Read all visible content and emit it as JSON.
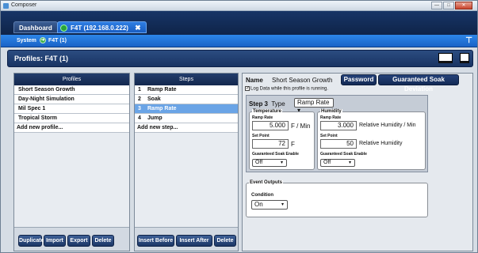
{
  "window": {
    "title": "Composer"
  },
  "tabs": [
    {
      "label": "Dashboard"
    },
    {
      "label": "F4T (192.168.0.222)"
    }
  ],
  "subnav": {
    "system": "System",
    "device": "F4T (1)"
  },
  "header": {
    "title": "Profiles: F4T (1)"
  },
  "profiles": {
    "heading": "Profiles",
    "items": [
      "Short Season Growth",
      "Day-Night Simulation",
      "Mil Spec 1",
      "Tropical Storm"
    ],
    "add_new": "Add new profile...",
    "buttons": {
      "duplicate": "Duplicate",
      "import": "Import",
      "export": "Export",
      "delete": "Delete"
    }
  },
  "steps": {
    "heading": "Steps",
    "items": [
      {
        "num": "1",
        "label": "Ramp Rate"
      },
      {
        "num": "2",
        "label": "Soak"
      },
      {
        "num": "3",
        "label": "Ramp Rate"
      },
      {
        "num": "4",
        "label": "Jump"
      }
    ],
    "add_new": "Add new step...",
    "buttons": {
      "insert_before": "Insert Before",
      "insert_after": "Insert After",
      "delete": "Delete"
    }
  },
  "detail": {
    "name_label": "Name",
    "name_value": "Short Season Growth",
    "password_button": "Password",
    "gsd_button": "Guaranteed Soak Deviation",
    "log_check": "✓",
    "log_label": "Log Data while this profile is running.",
    "step_label": "Step 3",
    "type_label": "Type",
    "type_value": "Ramp Rate",
    "temperature": {
      "title": "Temperature",
      "ramp_rate_label": "Ramp Rate",
      "ramp_rate_value": "5.000",
      "ramp_rate_unit": "F / Min",
      "set_point_label": "Set Point",
      "set_point_value": "72",
      "set_point_unit": "F",
      "gse_label": "Guaranteed Soak Enable",
      "gse_value": "Off"
    },
    "humidity": {
      "title": "Humidity",
      "ramp_rate_label": "Ramp Rate",
      "ramp_rate_value": "3.000",
      "ramp_rate_unit": "Relative Humidity / Min",
      "set_point_label": "Set Point",
      "set_point_value": "50",
      "set_point_unit": "Relative Humidity",
      "gse_label": "Guaranteed Soak Enable",
      "gse_value": "Off"
    },
    "events": {
      "title": "Event Outputs",
      "condition_label": "Condition",
      "condition_value": "On"
    }
  }
}
